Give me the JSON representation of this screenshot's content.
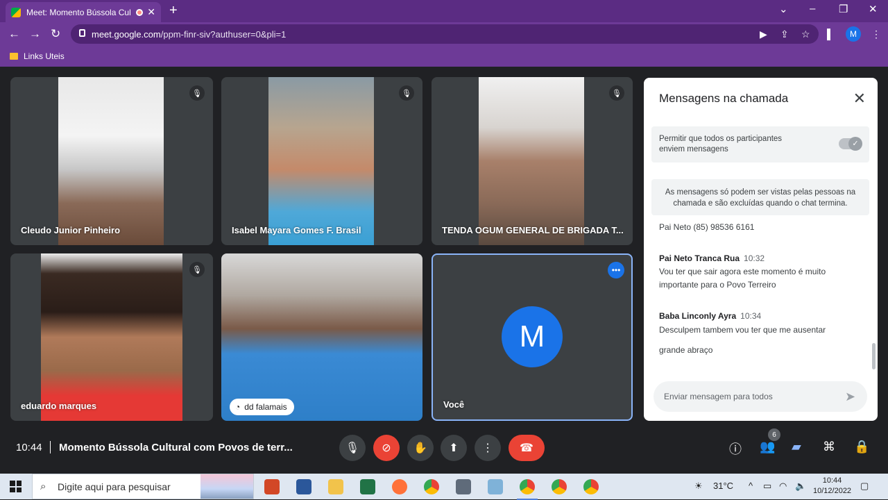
{
  "browser": {
    "tab_title": "Meet: Momento Bússola Cul",
    "url_domain": "meet.google.com",
    "url_path": "/ppm-finr-siv?authuser=0&pli=1",
    "profile_initial": "M",
    "bookmark_folder": "Links Uteis",
    "window_controls": [
      "⌄",
      "–",
      "❐",
      "✕"
    ]
  },
  "tiles": [
    {
      "name": "Cleudo Junior Pinheiro",
      "muted": true
    },
    {
      "name": "Isabel Mayara Gomes F. Brasil",
      "muted": true
    },
    {
      "name": "TENDA OGUM GENERAL DE BRIGADA T...",
      "muted": true
    },
    {
      "name": "eduardo marques",
      "muted": true
    },
    {
      "name": "dd falamais",
      "muted": false
    },
    {
      "name": "Você",
      "avatar_initial": "M"
    }
  ],
  "chat": {
    "title": "Mensagens na chamada",
    "permission_text": "Permitir que todos os participantes enviem mensagens",
    "notice": "As mensagens só podem ser vistas pelas pessoas na chamada e são excluídas quando o chat termina.",
    "orphan_line": "Pai Neto (85) 98536 6161",
    "messages": [
      {
        "sender": "Pai Neto Tranca Rua",
        "time": "10:32",
        "lines": [
          "Vou ter que sair agora este momento é muito",
          "importante para o Povo Terreiro"
        ]
      },
      {
        "sender": "Baba Linconly Ayra",
        "time": "10:34",
        "lines": [
          "Desculpem tambem vou ter que me ausentar",
          "grande abraço"
        ]
      }
    ],
    "input_placeholder": "Enviar mensagem para todos"
  },
  "meeting": {
    "time": "10:44",
    "title": "Momento Bússola Cultural com Povos de terr...",
    "participant_count": "6"
  },
  "taskbar": {
    "search_placeholder": "Digite aqui para pesquisar",
    "weather": "31°C",
    "clock_time": "10:44",
    "clock_date": "10/12/2022"
  },
  "colors": {
    "browser_frame": "#6d3a97",
    "meet_background": "#202124",
    "tile_background": "#3c4043",
    "accent_blue": "#1a73e8",
    "end_call_red": "#ea4335"
  }
}
